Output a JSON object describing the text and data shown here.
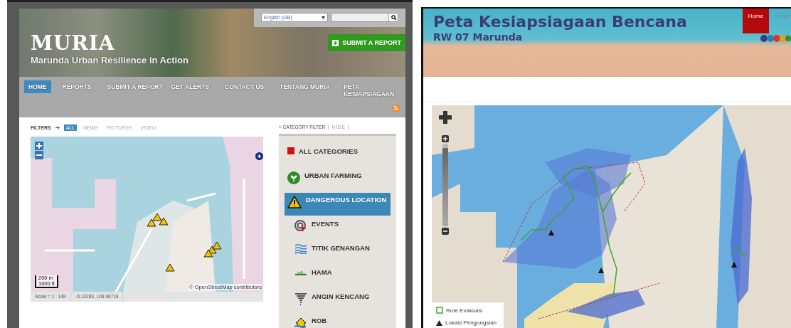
{
  "left_page": {
    "language_select": {
      "value": "English (GB)"
    },
    "site_title": "MURIA",
    "tagline": "Marunda Urban Resilience in Action",
    "submit_button": "SUBMIT A REPORT",
    "nav": [
      {
        "label": "HOME",
        "selected": true
      },
      {
        "label": "REPORTS",
        "selected": false
      },
      {
        "label": "SUBMIT A REPORT",
        "selected": false
      },
      {
        "label": "GET ALERTS",
        "selected": false
      },
      {
        "label": "CONTACT US",
        "selected": false
      },
      {
        "label": "TENTANG MURIA",
        "selected": false
      },
      {
        "label": "PETA KESIAPSIAGAAN",
        "selected": false
      }
    ],
    "filters": {
      "label": "FILTERS",
      "items": [
        {
          "label": "ALL",
          "selected": true
        },
        {
          "label": "NEWS",
          "selected": false
        },
        {
          "label": "PICTURES",
          "selected": false
        },
        {
          "label": "VIDEO",
          "selected": false
        }
      ]
    },
    "map": {
      "scale": "Scale = 1 : 14K",
      "coords": "-6.10283, 106.96718",
      "scale_bar": [
        "200 m",
        "1000 ft"
      ],
      "attribution": "© OpenStreetMap contributors"
    },
    "category_filter": {
      "title": "+ CATEGORY FILTER",
      "hide": "| HIDE |",
      "items": [
        {
          "label": "ALL CATEGORIES",
          "kind": "square",
          "selected": false
        },
        {
          "label": "URBAN FARMING",
          "kind": "farming",
          "selected": false
        },
        {
          "label": "DANGEROUS LOCATION",
          "kind": "warning",
          "selected": true
        },
        {
          "label": "EVENTS",
          "kind": "events",
          "selected": false
        },
        {
          "label": "TITIK GENANGAN",
          "kind": "water",
          "selected": false
        },
        {
          "label": "HAMA",
          "kind": "pest",
          "selected": false
        },
        {
          "label": "ANGIN KENCANG",
          "kind": "tornado",
          "selected": false
        },
        {
          "label": "ROB",
          "kind": "house",
          "selected": false
        }
      ]
    }
  },
  "right_page": {
    "title": "Peta Kesiapsiagaan Bencana",
    "subtitle": "RW 07 Marunda",
    "nav": [
      {
        "label": "Home",
        "selected": true
      },
      {
        "label": "Strukt",
        "selected": false
      }
    ],
    "zoom_slider": {
      "level": 0.95
    },
    "legend": [
      {
        "label": "Rute Evakuasi",
        "kind": "route"
      },
      {
        "label": "Lokasi Pengungsian",
        "kind": "shelter"
      }
    ]
  }
}
